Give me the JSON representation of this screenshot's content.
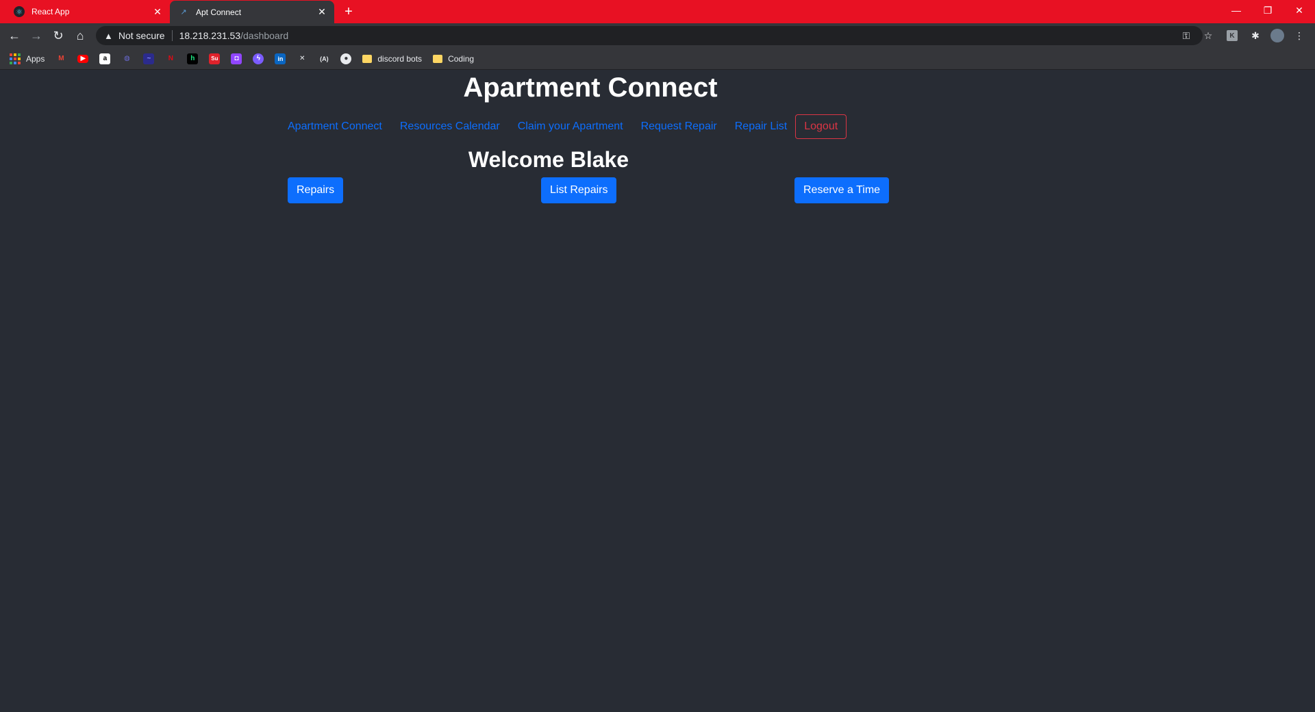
{
  "browser": {
    "tabs": [
      {
        "title": "React App",
        "active": false,
        "favicon": "react-icon"
      },
      {
        "title": "Apt Connect",
        "active": true,
        "favicon": "apt-connect-icon"
      }
    ],
    "address": {
      "security_label": "Not secure",
      "host": "18.218.231.53",
      "path": "/dashboard"
    },
    "bookmarks": {
      "apps_label": "Apps",
      "icons": [
        "gmail-icon",
        "youtube-icon",
        "amazon-icon",
        "bookmark-icon-4",
        "bookmark-icon-5",
        "netflix-icon",
        "hulu-icon",
        "supreme-icon",
        "twitch-icon",
        "messenger-icon",
        "linkedin-icon",
        "bookmark-icon-12",
        "bookmark-icon-13",
        "github-icon"
      ],
      "folders": [
        "discord bots",
        "Coding"
      ]
    },
    "accent_color": "#e81123"
  },
  "app": {
    "title": "Apartment Connect",
    "nav": {
      "links": [
        "Apartment Connect",
        "Resources Calendar",
        "Claim your Apartment",
        "Request Repair",
        "Repair List"
      ],
      "logout_label": "Logout"
    },
    "welcome": "Welcome Blake",
    "buttons": {
      "repairs": "Repairs",
      "list_repairs": "List Repairs",
      "reserve": "Reserve a Time"
    },
    "colors": {
      "background": "#282c34",
      "primary": "#0d6efd",
      "danger": "#dc3545"
    }
  }
}
